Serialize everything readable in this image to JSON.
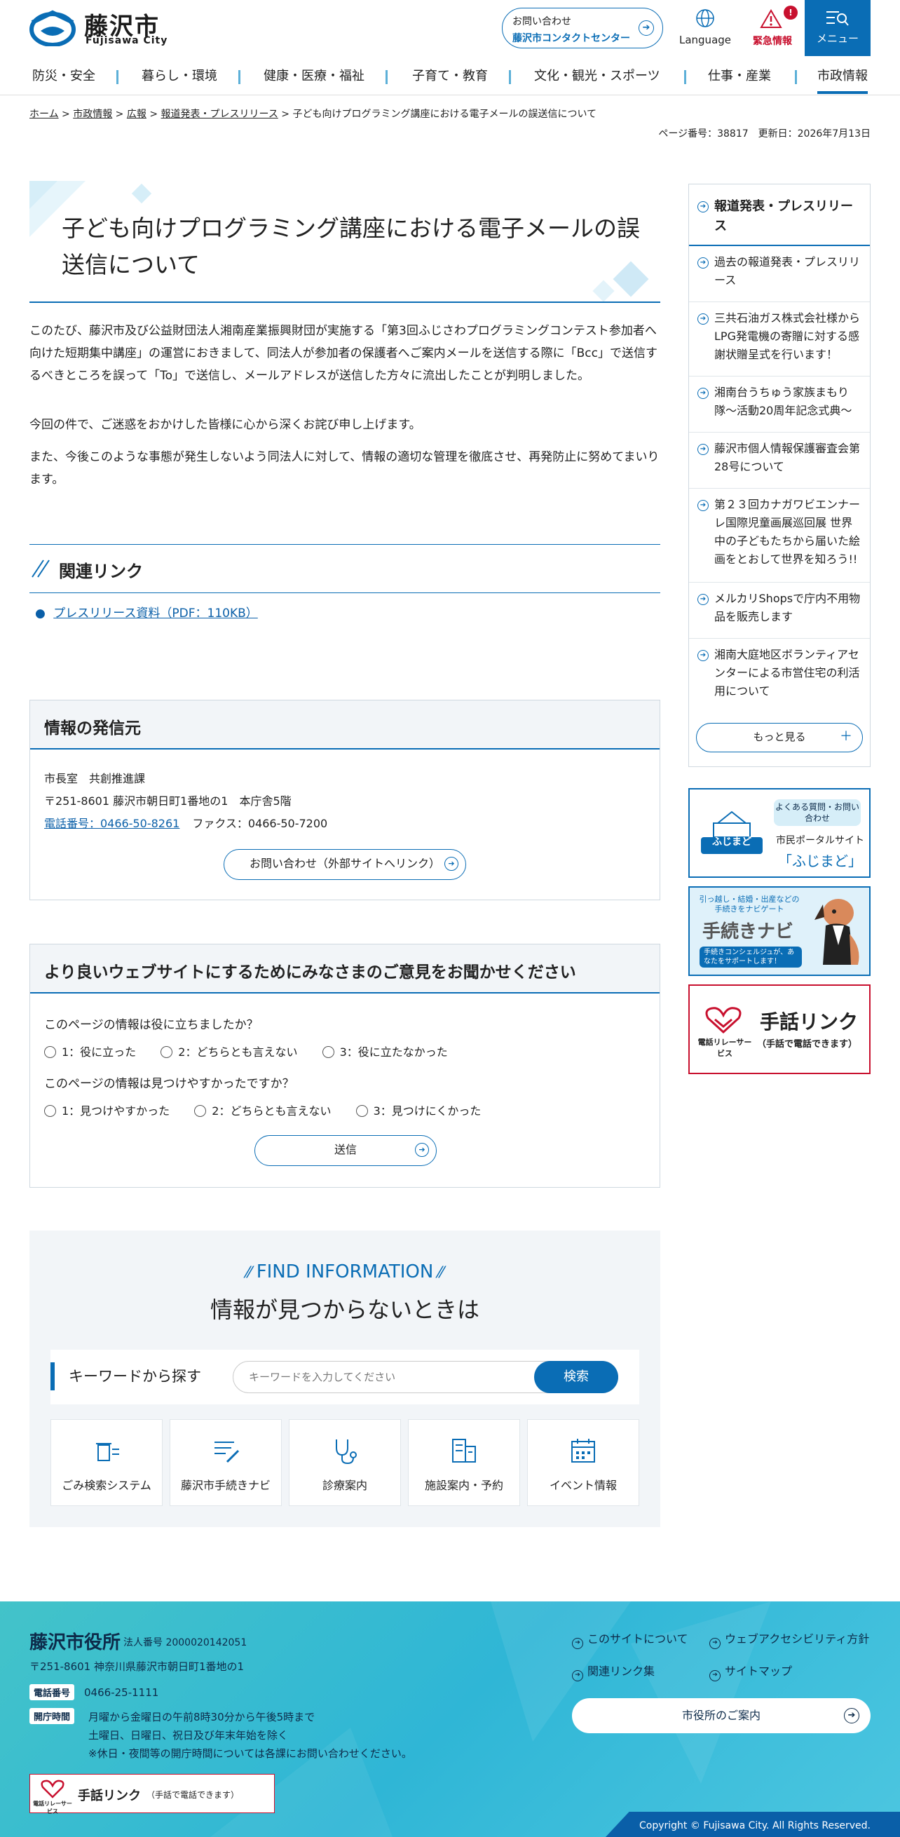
{
  "header": {
    "logo_ja": "藤沢市",
    "logo_en": "Fujisawa City",
    "contact_l1": "お問い合わせ",
    "contact_l2": "藤沢市コンタクトセンター",
    "language": "Language",
    "emergency": "緊急情報",
    "emergency_badge": "!",
    "menu": "メニュー"
  },
  "gnav": [
    "防災・安全",
    "暮らし・環境",
    "健康・医療・福祉",
    "子育て・教育",
    "文化・観光・スポーツ",
    "仕事・産業",
    "市政情報"
  ],
  "breadcrumb": {
    "home": "ホーム",
    "l1": "市政情報",
    "l2": "広報",
    "l3": "報道発表・プレスリリース",
    "current": "子ども向けプログラミング講座における電子メールの誤送信について",
    "sep": " > "
  },
  "pageinfo": "ページ番号：38817　更新日：2026年7月13日",
  "main": {
    "title": "子ども向けプログラミング講座における電子メールの誤送信について",
    "p1": "このたび、藤沢市及び公益財団法人湘南産業振興財団が実施する「第3回ふじさわプログラミングコンテスト参加者へ向けた短期集中講座」の運営におきまして、同法人が参加者の保護者へご案内メールを送信する際に「Bcc」で送信するべきところを誤って「To」で送信し、メールアドレスが送信した方々に流出したことが判明しました。",
    "p2": "今回の件で、ご迷惑をおかけした皆様に心から深くお詫び申し上げます。",
    "p3": "また、今後このような事態が発生しないよう同法人に対して、情報の適切な管理を徹底させ、再発防止に努めてまいります。",
    "related_heading": "関連リンク",
    "related_link": "プレスリリース資料（PDF：110KB）"
  },
  "info": {
    "heading": "情報の発信元",
    "dept": "市長室　共創推進課",
    "address": "〒251-8601 藤沢市朝日町1番地の1　本庁舎5階",
    "tel": "電話番号：0466-50-8261",
    "fax": "ファクス：0466-50-7200",
    "button": "お問い合わせ（外部サイトへリンク）"
  },
  "survey": {
    "heading": "より良いウェブサイトにするためにみなさまのご意見をお聞かせください",
    "q1": "このページの情報は役に立ちましたか？",
    "q1_opts": [
      "1：役に立った",
      "2：どちらとも言えない",
      "3：役に立たなかった"
    ],
    "q2": "このページの情報は見つけやすかったですか？",
    "q2_opts": [
      "1：見つけやすかった",
      "2：どちらとも言えない",
      "3：見つけにくかった"
    ],
    "submit": "送信"
  },
  "find": {
    "en": "FIND INFORMATION",
    "ja": "情報が見つからないときは",
    "kw_label": "キーワードから探す",
    "kw_placeholder": "キーワードを入力してください",
    "kw_button": "検索",
    "tiles": [
      "ごみ検索システム",
      "藤沢市手続きナビ",
      "診療案内",
      "施設案内・予約",
      "イベント情報"
    ]
  },
  "side": {
    "heading": "報道発表・プレスリリース",
    "items": [
      "過去の報道発表・プレスリリース",
      "三共石油ガス株式会社様からLPG発電機の寄贈に対する感謝状贈呈式を行います！",
      "湘南台うちゅう家族まもり隊〜活動20周年記念式典〜",
      "藤沢市個人情報保護審査会第28号について",
      "第２３回カナガワビエンナーレ国際児童画展巡回展 世界中の子どもたちから届いた絵画をとおして世界を知ろう!!",
      "メルカリShopsで庁内不用物品を販売します",
      "湘南大庭地区ボランティアセンターによる市営住宅の利活用について"
    ],
    "more": "もっと見る",
    "more_plus": "＋"
  },
  "banners": {
    "fujimado_logo": "ふじまど",
    "fujimado_tag": "よくある質問・お問い合わせ",
    "fujimado_l1": "市民ポータルサイト",
    "fujimado_l2": "「ふじまど」",
    "navi_tag": "引っ越し・結婚・出産などの手続きをナビゲート",
    "navi_title": "手続きナビ",
    "navi_sub": "手続きコンシェルジュが、あなたをサポートします！",
    "relay_logo": "電話リレーサービス",
    "relay_title": "手話リンク",
    "relay_sub": "（手話で電話できます）"
  },
  "footer": {
    "name": "藤沢市役所",
    "corp": "法人番号 2000020142051",
    "address": "〒251-8601 神奈川県藤沢市朝日町1番地の1",
    "tel_label": "電話番号",
    "tel": "0466-25-1111",
    "hours_label": "開庁時間",
    "hours1": "月曜から金曜日の午前8時30分から午後5時まで",
    "hours2": "土曜日、日曜日、祝日及び年末年始を除く",
    "hours3": "※休日・夜間等の開庁時間については各課にお問い合わせください。",
    "relay": "手話リンク",
    "relay_sub": "（手話で電話できます）",
    "relay_logo": "電話リレーサービス",
    "links": [
      "このサイトについて",
      "ウェブアクセシビリティ方針",
      "関連リンク集",
      "サイトマップ"
    ],
    "guide": "市役所のご案内",
    "copyright": "Copyright © Fujisawa City. All Rights Reserved."
  }
}
